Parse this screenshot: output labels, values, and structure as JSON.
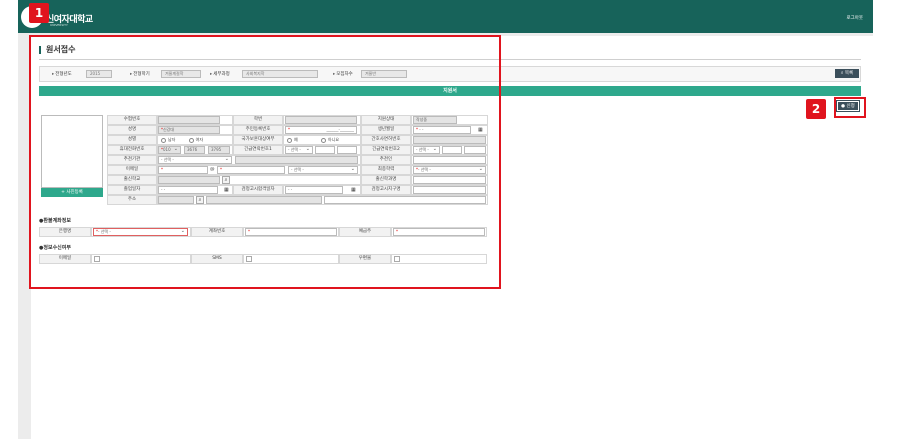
{
  "header": {
    "logo_text": "신여자대학교",
    "logo_sub": "UNIVERSITY",
    "logout": "로그아웃"
  },
  "page": {
    "title": "원서접수"
  },
  "search": {
    "year_label": "전형년도",
    "year_value": "2015",
    "term_label": "전형학기",
    "term_value": "겨울계절학",
    "course_label": "세부과정",
    "course_value": "사회복지학",
    "round_label": "모집차수",
    "round_value": "겨울반",
    "list_button": "목록"
  },
  "banner": "지원서",
  "apply_button": "신청",
  "photo_button": "사진등록",
  "form": {
    "exam_no": "수험번호",
    "student_no": "학번",
    "status": "지원상태",
    "status_value": "작성중",
    "name": "성명",
    "name_value": "신강대",
    "resident_no": "주민등록번호",
    "resident_value": "______-_______",
    "birth": "생년월일",
    "birth_value": "-  -",
    "gender": "성별",
    "male": "남자",
    "female": "여자",
    "veteran": "국가보훈대상여부",
    "yes": "예",
    "no": "아니요",
    "nurse_license": "간호사면허번호",
    "mobile": "휴대전화번호",
    "mobile_1": "010",
    "mobile_2": "3676",
    "mobile_3": "3795",
    "emergency1": "긴급연락번호1",
    "emergency2": "긴급연락번호2",
    "select": "- 선택 -",
    "recommend_org": "추천기관",
    "recommender": "추천인",
    "email": "이메일",
    "at": "@",
    "degree": "최종학력",
    "school": "출신학교",
    "major": "출신학과명",
    "grad_date": "졸업일자",
    "date_blank": "-  -",
    "ged_date": "검정고시합격일자",
    "ged_region": "검정고시지구명",
    "address": "주소"
  },
  "refund": {
    "title": "환불계좌정보",
    "bank": "은행명",
    "account": "계좌번호",
    "depositor": "예금주"
  },
  "notify": {
    "title": "정보수신여부",
    "email": "이메일",
    "sms": "SMS",
    "mail": "우편물"
  },
  "markers": {
    "one": "1",
    "two": "2"
  }
}
